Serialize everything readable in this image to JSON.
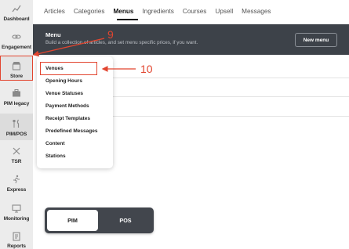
{
  "sidebar": {
    "items": [
      {
        "label": "Dashboard",
        "icon": "chart-line-icon"
      },
      {
        "label": "Engagement",
        "icon": "link-icon"
      },
      {
        "label": "Store",
        "icon": "store-icon"
      },
      {
        "label": "PIM legacy",
        "icon": "briefcase-icon"
      },
      {
        "label": "PIM/POS",
        "icon": "fork-knife-icon"
      },
      {
        "label": "TSR",
        "icon": "utensils-cross-icon"
      },
      {
        "label": "Express",
        "icon": "runner-icon"
      },
      {
        "label": "Monitoring",
        "icon": "monitor-icon"
      },
      {
        "label": "Reports",
        "icon": "report-icon"
      }
    ]
  },
  "tabs": [
    "Articles",
    "Categories",
    "Menus",
    "Ingredients",
    "Courses",
    "Upsell",
    "Messages"
  ],
  "active_tab": "Menus",
  "banner": {
    "title": "Menu",
    "subtitle": "Build a collection of articles, and set menu specific prices, if you want.",
    "new_menu_label": "New menu"
  },
  "dropdown": {
    "items": [
      "Venues",
      "Opening Hours",
      "Venue Statuses",
      "Payment Methods",
      "Receipt Templates",
      "Predefined Messages",
      "Content",
      "Stations"
    ]
  },
  "annotations": {
    "step_9": "9",
    "step_10": "10",
    "color": "#e2452f"
  },
  "toggle": {
    "pim_label": "PIM",
    "pos_label": "POS",
    "selected": "PIM"
  },
  "colors": {
    "banner": "#3d4249",
    "sidebar": "#ececec",
    "highlight": "#e2452f"
  }
}
